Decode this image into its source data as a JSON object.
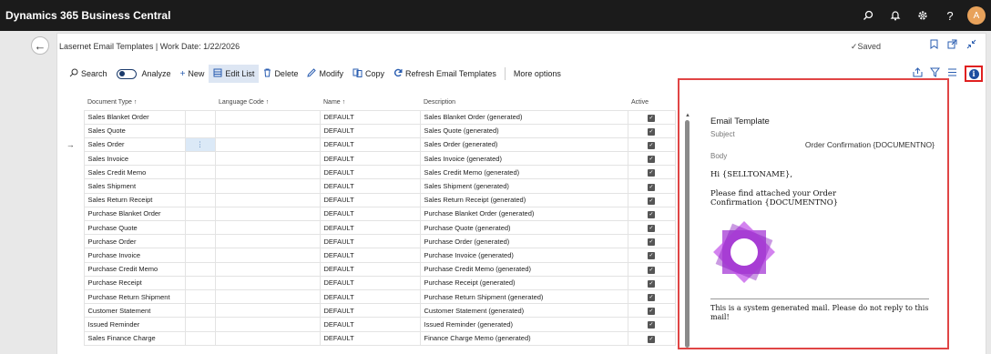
{
  "app": {
    "title": "Dynamics 365 Business Central",
    "avatar_initial": "A"
  },
  "top_icons": [
    "search-icon",
    "bell-icon",
    "gear-icon",
    "help-icon"
  ],
  "page": {
    "title": "Lasernet Email Templates | Work Date: 1/22/2026",
    "saved": "Saved"
  },
  "actions": {
    "search": "Search",
    "analyze": "Analyze",
    "new": "New",
    "edit_list": "Edit List",
    "delete": "Delete",
    "modify": "Modify",
    "copy": "Copy",
    "refresh": "Refresh Email Templates",
    "more": "More options"
  },
  "columns": {
    "document_type": "Document Type ↑",
    "language_code": "Language Code ↑",
    "name": "Name ↑",
    "description": "Description",
    "active": "Active"
  },
  "rows": [
    {
      "doc": "Sales Blanket Order",
      "name": "DEFAULT",
      "desc": "Sales Blanket Order (generated)"
    },
    {
      "doc": "Sales Quote",
      "name": "DEFAULT",
      "desc": "Sales Quote (generated)"
    },
    {
      "doc": "Sales Order",
      "name": "DEFAULT",
      "desc": "Sales Order (generated)"
    },
    {
      "doc": "Sales Invoice",
      "name": "DEFAULT",
      "desc": "Sales Invoice (generated)"
    },
    {
      "doc": "Sales Credit Memo",
      "name": "DEFAULT",
      "desc": "Sales Credit Memo (generated)"
    },
    {
      "doc": "Sales Shipment",
      "name": "DEFAULT",
      "desc": "Sales Shipment (generated)"
    },
    {
      "doc": "Sales Return Receipt",
      "name": "DEFAULT",
      "desc": "Sales Return Receipt (generated)"
    },
    {
      "doc": "Purchase Blanket Order",
      "name": "DEFAULT",
      "desc": "Purchase Blanket Order (generated)"
    },
    {
      "doc": "Purchase Quote",
      "name": "DEFAULT",
      "desc": "Purchase Quote (generated)"
    },
    {
      "doc": "Purchase Order",
      "name": "DEFAULT",
      "desc": "Purchase Order (generated)"
    },
    {
      "doc": "Purchase Invoice",
      "name": "DEFAULT",
      "desc": "Purchase Invoice (generated)"
    },
    {
      "doc": "Purchase Credit Memo",
      "name": "DEFAULT",
      "desc": "Purchase Credit Memo (generated)"
    },
    {
      "doc": "Purchase Receipt",
      "name": "DEFAULT",
      "desc": "Purchase Receipt (generated)"
    },
    {
      "doc": "Purchase Return Shipment",
      "name": "DEFAULT",
      "desc": "Purchase Return Shipment (generated)"
    },
    {
      "doc": "Customer Statement",
      "name": "DEFAULT",
      "desc": "Customer Statement (generated)"
    },
    {
      "doc": "Issued Reminder",
      "name": "DEFAULT",
      "desc": "Issued Reminder (generated)"
    },
    {
      "doc": "Sales Finance Charge",
      "name": "DEFAULT",
      "desc": "Finance Charge Memo (generated)"
    }
  ],
  "selected_row_index": 2,
  "factbox": {
    "heading": "Email Template",
    "subject_label": "Subject",
    "subject_value": "Order Confirmation {DOCUMENTNO}",
    "body_label": "Body",
    "greeting": "Hi {SELLTONAME},",
    "message": "Please find attached your Order Confirmation {DOCUMENTNO}",
    "footer": "This is a system generated mail. Please do not reply to this mail!"
  },
  "colors": {
    "accent": "#2a5db0",
    "highlight_border": "#e04545",
    "logo": "#9b30c8"
  }
}
